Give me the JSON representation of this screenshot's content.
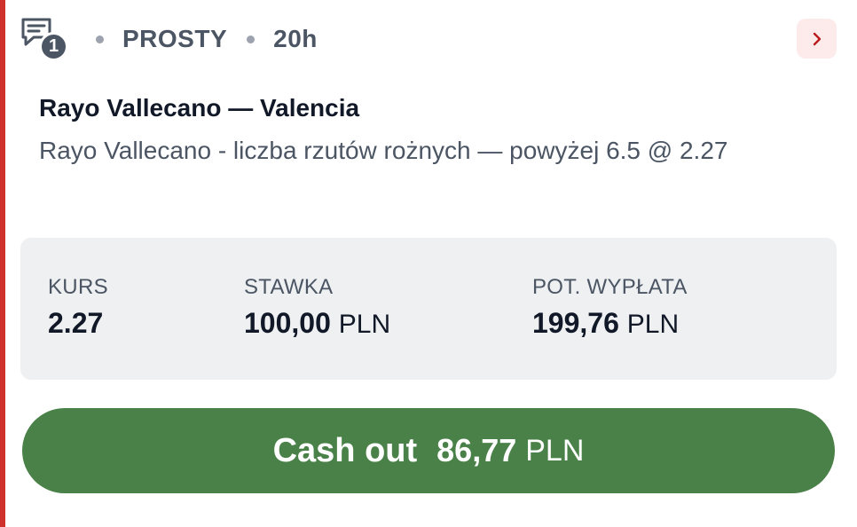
{
  "header": {
    "bet_count": "1",
    "bet_type": "PROSTY",
    "time_left": "20h"
  },
  "bet": {
    "match": "Rayo Vallecano — Valencia",
    "selection": "Rayo Vallecano - liczba rzutów rożnych — powyżej 6.5 @ 2.27"
  },
  "stats": {
    "odds_label": "KURS",
    "odds_value": "2.27",
    "stake_label": "STAWKA",
    "stake_value": "100,00",
    "stake_currency": "PLN",
    "payout_label": "POT. WYPŁATA",
    "payout_value": "199,76",
    "payout_currency": "PLN"
  },
  "cashout": {
    "label": "Cash out",
    "amount": "86,77",
    "currency": "PLN"
  },
  "colors": {
    "accent_red": "#d0312d",
    "cashout_green": "#4a8148",
    "stats_bg": "#eef0f2"
  },
  "icons": {
    "bet_slip": "receipt-chat-icon",
    "expand": "chevron-right-icon"
  }
}
